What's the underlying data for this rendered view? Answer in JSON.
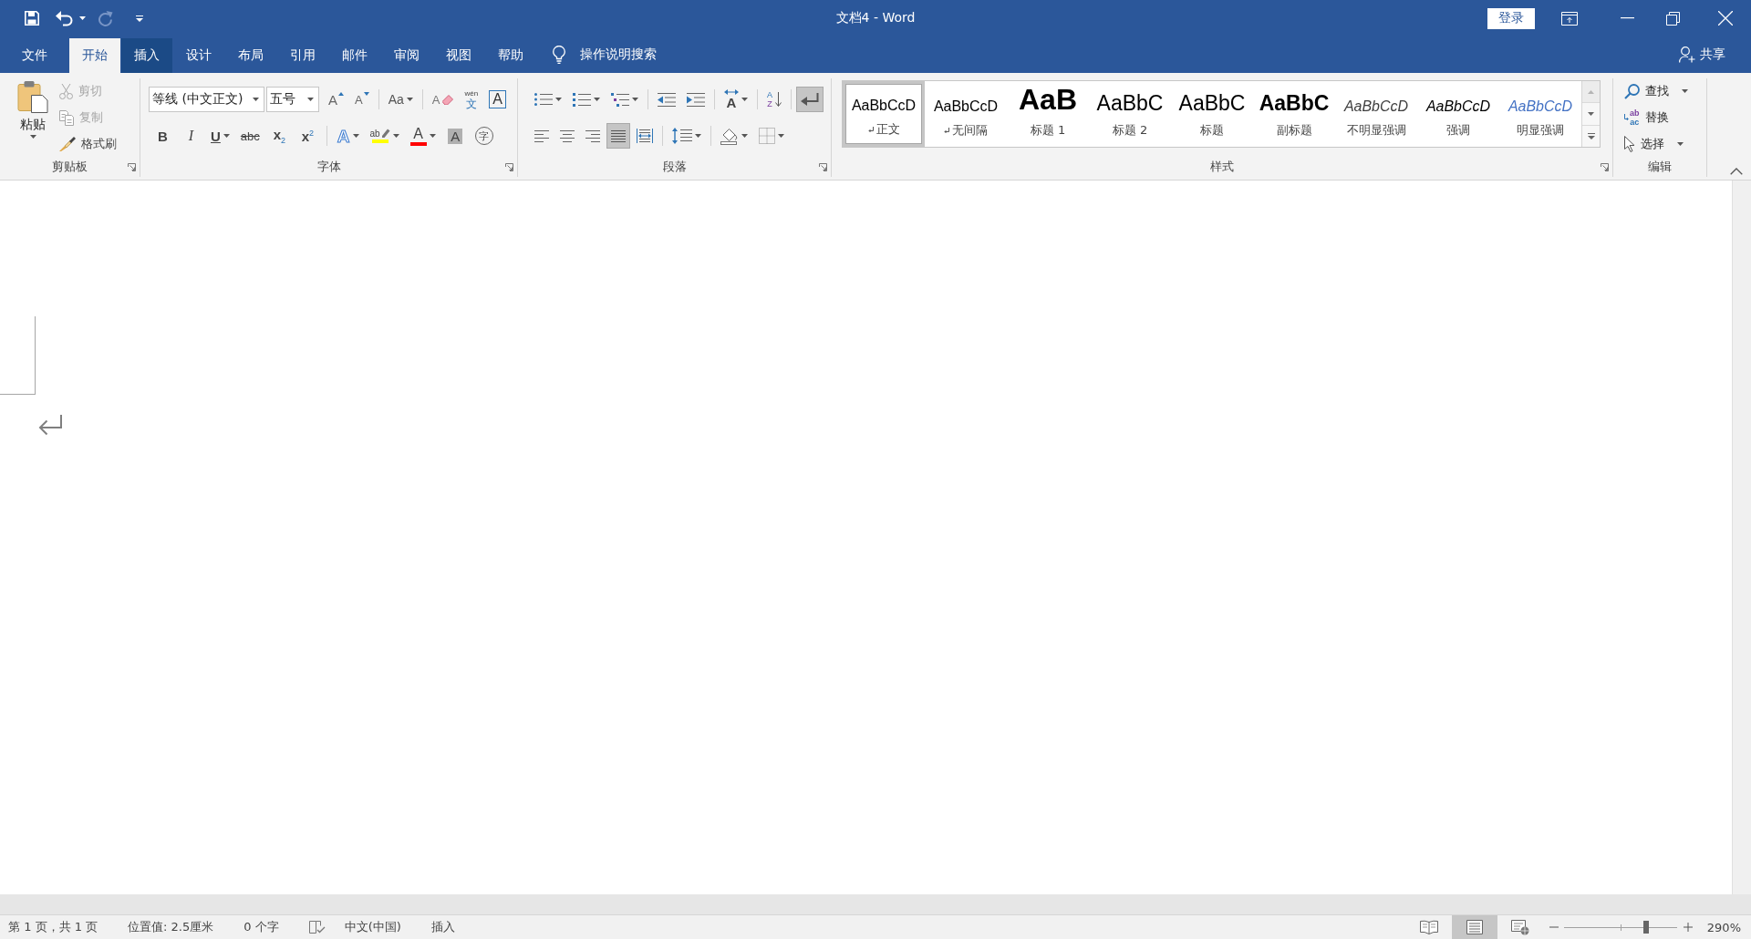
{
  "window": {
    "title": "文档4 - Word",
    "sign_in": "登录"
  },
  "quick_access": [
    {
      "kind": "save",
      "dropdown": false,
      "disabled": false
    },
    {
      "kind": "undo",
      "dropdown": true,
      "disabled": false
    },
    {
      "kind": "redo",
      "dropdown": false,
      "disabled": true
    },
    {
      "kind": "customize",
      "dropdown": false,
      "disabled": false
    }
  ],
  "tabs": [
    {
      "label": "文件",
      "selected": false,
      "hovered": false
    },
    {
      "label": "开始",
      "selected": true,
      "hovered": false
    },
    {
      "label": "插入",
      "selected": false,
      "hovered": true
    },
    {
      "label": "设计",
      "selected": false,
      "hovered": false
    },
    {
      "label": "布局",
      "selected": false,
      "hovered": false
    },
    {
      "label": "引用",
      "selected": false,
      "hovered": false
    },
    {
      "label": "邮件",
      "selected": false,
      "hovered": false
    },
    {
      "label": "审阅",
      "selected": false,
      "hovered": false
    },
    {
      "label": "视图",
      "selected": false,
      "hovered": false
    },
    {
      "label": "帮助",
      "selected": false,
      "hovered": false
    }
  ],
  "tell_me": "操作说明搜索",
  "share": "共享",
  "clipboard": {
    "label": "剪贴板",
    "launcher": true,
    "paste": "粘贴",
    "tools": [
      {
        "kind": "cut",
        "label": "剪切",
        "disabled": true
      },
      {
        "kind": "copy",
        "label": "复制",
        "disabled": true
      },
      {
        "kind": "format_painter",
        "label": "格式刷",
        "disabled": false
      }
    ]
  },
  "font": {
    "label": "字体",
    "launcher": true,
    "font_name": "等线 (中文正文)",
    "font_size": "五号",
    "row_1": [
      [
        {
          "kind": "grow",
          "glyph": "A",
          "dropdown": false,
          "pressed": false
        },
        {
          "kind": "shrink",
          "glyph": "A",
          "dropdown": false,
          "pressed": false
        }
      ],
      [
        {
          "kind": "change_case",
          "glyph": "Aa",
          "dropdown": true,
          "pressed": false
        }
      ],
      [
        {
          "kind": "clear_format",
          "glyph": "A",
          "dropdown": false,
          "pressed": false
        },
        {
          "kind": "phonetic",
          "glyph": "wén",
          "glyph_2": "文",
          "dropdown": false,
          "pressed": false
        },
        {
          "kind": "char_border",
          "glyph": "A",
          "dropdown": false,
          "pressed": false
        }
      ]
    ],
    "row_2": [
      [
        {
          "kind": "bold",
          "glyph": "B",
          "dropdown": false,
          "pressed": false
        },
        {
          "kind": "italic",
          "glyph": "I",
          "dropdown": false,
          "pressed": false
        },
        {
          "kind": "underline",
          "glyph": "U",
          "dropdown": true,
          "pressed": false
        },
        {
          "kind": "strike",
          "glyph": "abc",
          "dropdown": false,
          "pressed": false
        },
        {
          "kind": "subscript",
          "glyph": "x$_{2}$",
          "dropdown": false,
          "pressed": false
        },
        {
          "kind": "superscript",
          "glyph": "x$^{2}$",
          "dropdown": false,
          "pressed": false
        }
      ],
      [
        {
          "kind": "text_effects",
          "glyph": "A",
          "dropdown": true,
          "pressed": false
        },
        {
          "kind": "highlight",
          "glyph": "ab",
          "dropdown": true,
          "pressed": false,
          "color": "#ffff00"
        },
        {
          "kind": "font_color",
          "glyph": "A",
          "dropdown": true,
          "pressed": false,
          "color": "#ff0000"
        },
        {
          "kind": "char_shading",
          "glyph": "A",
          "dropdown": false,
          "pressed": false
        },
        {
          "kind": "enclose",
          "glyph": "字",
          "dropdown": false,
          "pressed": false
        }
      ]
    ]
  },
  "paragraph": {
    "label": "段落",
    "launcher": true,
    "row_1": [
      [
        {
          "kind": "bullets",
          "dropdown": true,
          "pressed": false
        },
        {
          "kind": "numbering",
          "dropdown": true,
          "pressed": false
        },
        {
          "kind": "multilevel",
          "dropdown": true,
          "pressed": false
        }
      ],
      [
        {
          "kind": "decrease_indent",
          "dropdown": false,
          "pressed": false
        },
        {
          "kind": "increase_indent",
          "dropdown": false,
          "pressed": false
        }
      ],
      [
        {
          "kind": "chinese_layout",
          "glyph": "A",
          "dropdown": true,
          "pressed": false
        }
      ],
      [
        {
          "kind": "sort",
          "glyph": "A",
          "glyph_2": "Z",
          "dropdown": false,
          "pressed": false
        }
      ],
      [
        {
          "kind": "show_marks",
          "dropdown": false,
          "pressed": true
        }
      ]
    ],
    "row_2": [
      [
        {
          "kind": "align_left",
          "dropdown": false,
          "pressed": false
        },
        {
          "kind": "align_center",
          "dropdown": false,
          "pressed": false
        },
        {
          "kind": "align_right",
          "dropdown": false,
          "pressed": false
        },
        {
          "kind": "justify",
          "dropdown": false,
          "pressed": true
        },
        {
          "kind": "distribute",
          "dropdown": false,
          "pressed": false
        }
      ],
      [
        {
          "kind": "line_spacing",
          "dropdown": true,
          "pressed": false
        }
      ],
      [
        {
          "kind": "shading",
          "dropdown": true,
          "pressed": false
        },
        {
          "kind": "borders",
          "dropdown": true,
          "pressed": false
        }
      ]
    ]
  },
  "styles": {
    "label": "样式",
    "launcher": true,
    "items": [
      {
        "kind": "normal",
        "preview": "AaBbCcD",
        "name": "正文",
        "paragraph_style": true,
        "selected": true
      },
      {
        "kind": "no_spacing",
        "preview": "AaBbCcD",
        "name": "无间隔",
        "paragraph_style": true,
        "selected": false
      },
      {
        "kind": "heading1",
        "preview": "AaB",
        "name": "标题 1",
        "paragraph_style": false,
        "selected": false
      },
      {
        "kind": "heading2",
        "preview": "AaBbC",
        "name": "标题 2",
        "paragraph_style": false,
        "selected": false
      },
      {
        "kind": "title",
        "preview": "AaBbC",
        "name": "标题",
        "paragraph_style": false,
        "selected": false
      },
      {
        "kind": "subtitle",
        "preview": "AaBbC",
        "name": "副标题",
        "paragraph_style": false,
        "selected": false
      },
      {
        "kind": "subtle_emphasis",
        "preview": "AaBbCcD",
        "name": "不明显强调",
        "paragraph_style": false,
        "selected": false
      },
      {
        "kind": "emphasis",
        "preview": "AaBbCcD",
        "name": "强调",
        "paragraph_style": false,
        "selected": false
      },
      {
        "kind": "intense_emphasis",
        "preview": "AaBbCcD",
        "name": "明显强调",
        "paragraph_style": false,
        "selected": false
      }
    ]
  },
  "editing": {
    "label": "编辑",
    "launcher": false,
    "items": [
      {
        "kind": "find",
        "label": "查找",
        "dropdown": true
      },
      {
        "kind": "replace",
        "label": "替换",
        "dropdown": false,
        "glyph": "ab",
        "glyph_2": "ac"
      },
      {
        "kind": "select",
        "label": "选择",
        "dropdown": true
      }
    ]
  },
  "status_bar": {
    "items": [
      {
        "kind": "page",
        "text": "第 1 页，共 1 页"
      },
      {
        "kind": "position",
        "text": "位置值: 2.5厘米"
      },
      {
        "kind": "word_count",
        "text": "0 个字"
      },
      {
        "kind": "proofing"
      },
      {
        "kind": "language",
        "text": "中文(中国)"
      },
      {
        "kind": "mode",
        "text": "插入"
      }
    ],
    "views": [
      {
        "kind": "read",
        "selected": false
      },
      {
        "kind": "print",
        "selected": true
      },
      {
        "kind": "web",
        "selected": false
      }
    ],
    "zoom": {
      "level": 0.73,
      "percent": "290%"
    }
  }
}
